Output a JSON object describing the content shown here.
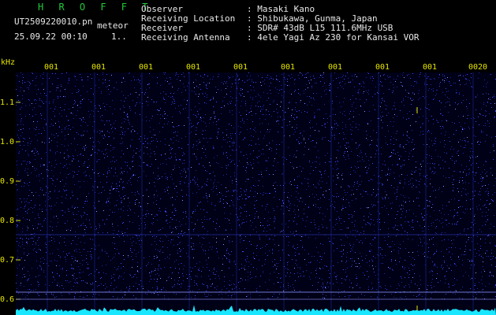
{
  "header": {
    "brand": "H R O F F T",
    "filename": "UT2509220010.pn",
    "tag": "meteor",
    "datetime": "25.09.22 00:10",
    "index": "1..",
    "rows": [
      {
        "label": "Observer",
        "value": ": Masaki Kano"
      },
      {
        "label": "Receiving Location",
        "value": ": Shibukawa, Gunma, Japan"
      },
      {
        "label": "Receiver",
        "value": ": SDR# 43dB L15 111.6MHz USB"
      },
      {
        "label": "Receiving Antenna",
        "value": ": 4ele Yagi Az 230 for Kansai VOR"
      }
    ]
  },
  "axis": {
    "y_unit": "kHz",
    "y_ticks": [
      "1.1",
      "1.0",
      "0.9",
      "0.8",
      "0.7",
      "0.6"
    ],
    "x_ticks": [
      "001",
      "001",
      "001",
      "001",
      "001",
      "001",
      "001",
      "001",
      "001",
      "0020"
    ]
  },
  "colors": {
    "background": "#000017",
    "signal": "#3d4bff",
    "baseline": "#19e6ff",
    "text": "#e6e600",
    "brand": "#22c93a"
  }
}
